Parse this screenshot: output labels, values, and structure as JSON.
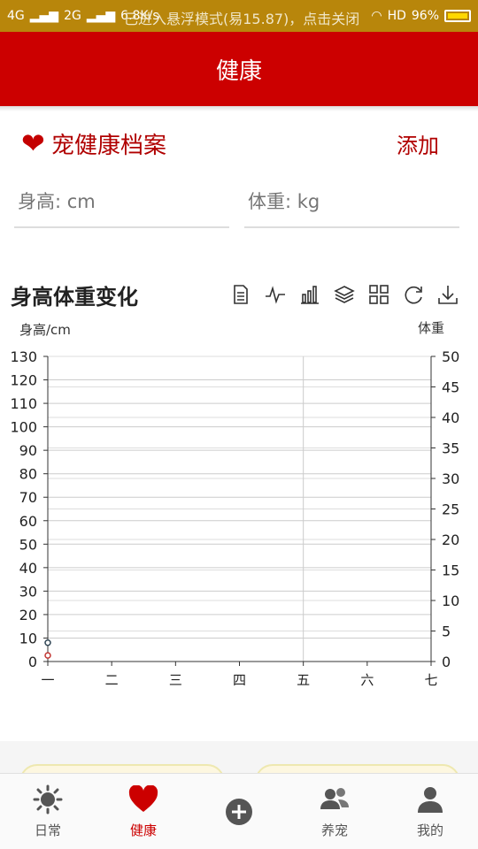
{
  "status": {
    "network_left": "4G",
    "network_mid": "2G",
    "speed": "6.8K/s",
    "overlay": "已进入悬浮模式(易15.87)，点击关闭",
    "hd": "HD",
    "battery": "96%"
  },
  "app": {
    "title": "健康"
  },
  "profile": {
    "title": "宠健康档案",
    "add_label": "添加",
    "height_placeholder": "身高: cm",
    "weight_placeholder": "体重: kg"
  },
  "chart_section": {
    "title": "身高体重变化",
    "tools": [
      "data-view-icon",
      "line-chart-icon",
      "bar-chart-icon",
      "stack-icon",
      "tiled-icon",
      "restore-icon",
      "download-icon"
    ]
  },
  "chart_data": {
    "type": "line",
    "categories": [
      "一",
      "二",
      "三",
      "四",
      "五",
      "六",
      "七"
    ],
    "y_left_label": "身高/cm",
    "y_right_label": "体重",
    "y_left_range": [
      0,
      130
    ],
    "y_right_range": [
      0,
      50
    ],
    "y_left_ticks": [
      0,
      10,
      20,
      30,
      40,
      50,
      60,
      70,
      80,
      90,
      100,
      110,
      120,
      130
    ],
    "y_right_ticks": [
      0,
      5,
      10,
      15,
      20,
      25,
      30,
      35,
      40,
      45,
      50
    ],
    "series": [
      {
        "name": "",
        "axis": "left",
        "values": [
          8
        ],
        "color": "#2f4554"
      },
      {
        "name": "",
        "axis": "right",
        "values": [
          1
        ],
        "color": "#c23531"
      }
    ]
  },
  "tabs": [
    {
      "label": "日常",
      "icon": "sun-icon"
    },
    {
      "label": "健康",
      "icon": "heart-icon",
      "active": true
    },
    {
      "label": "",
      "icon": "add-circle-icon"
    },
    {
      "label": "养宠",
      "icon": "people-icon"
    },
    {
      "label": "我的",
      "icon": "person-icon"
    }
  ],
  "colors": {
    "brand": "#cc0000",
    "status": "#b8860b"
  }
}
